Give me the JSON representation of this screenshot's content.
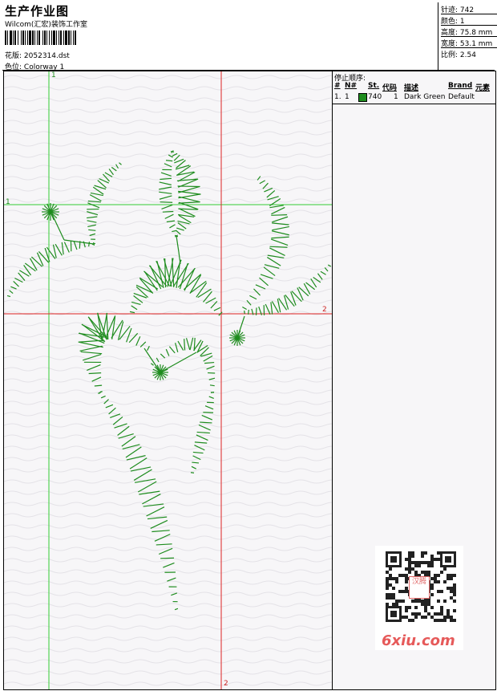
{
  "header": {
    "title": "生产作业图",
    "company": "Wilcom(汇宏)装饰工作室",
    "design_label": "花版:",
    "design_file": "2052314.dst",
    "colorway_label": "色位:",
    "colorway_value": "Colorway 1"
  },
  "stats": {
    "stitches": "针迹: 742",
    "colors": "颜色: 1",
    "height": "高度: 75.8 mm",
    "width": "宽度: 53.1 mm",
    "scale": "比例: 2.54"
  },
  "guides": {
    "green_v_label": "1",
    "green_h_label": "1",
    "red_h_label": "2",
    "red_v_label": "2"
  },
  "stop_sequence": {
    "title": "停止顺序:",
    "headers": [
      "#",
      "N#",
      "St.",
      "代码",
      "描述",
      "Brand",
      "元素"
    ],
    "rows": [
      {
        "num": "1.",
        "n": "1",
        "stitches": "740",
        "code": "1",
        "description": "Dark Green",
        "brand": "Default"
      }
    ]
  },
  "thread_color": "#1e8c1e",
  "watermark": {
    "site": "6xiu.com",
    "stamp": "汉腾"
  }
}
